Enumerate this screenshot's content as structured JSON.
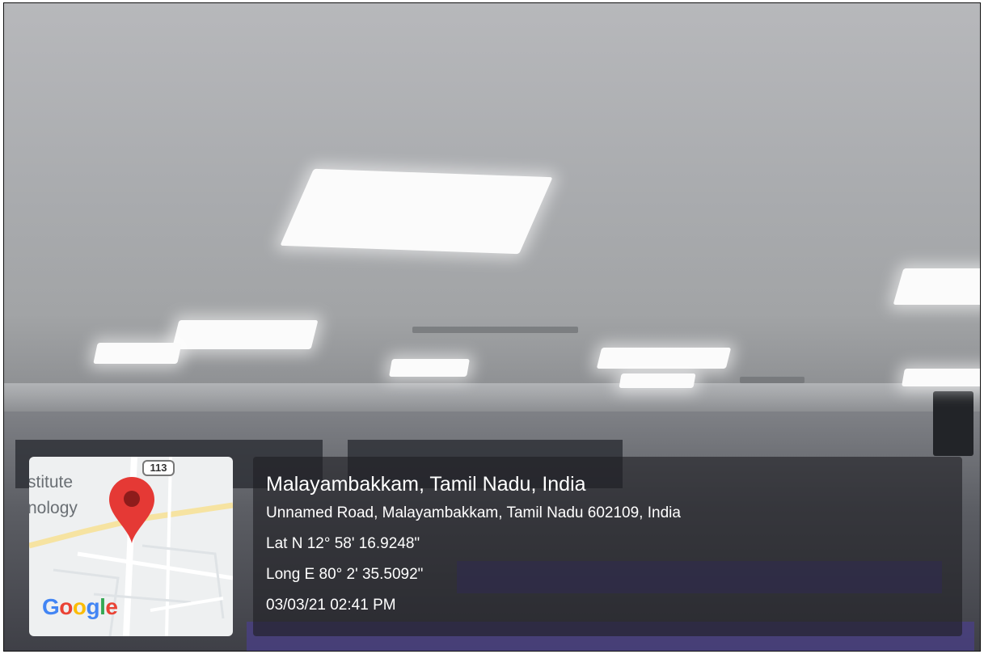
{
  "map": {
    "route_number": "113",
    "label_line1": "stitute",
    "label_line2": "nology",
    "logo_letters": [
      "G",
      "o",
      "o",
      "g",
      "l",
      "e"
    ],
    "pin_color": "#e53935"
  },
  "location": {
    "title": "Malayambakkam, Tamil Nadu, India",
    "address": "Unnamed Road, Malayambakkam, Tamil Nadu 602109, India",
    "latitude": "Lat N 12° 58' 16.9248\"",
    "longitude": "Long E 80° 2' 35.5092\"",
    "datetime": "03/03/21 02:41 PM"
  }
}
